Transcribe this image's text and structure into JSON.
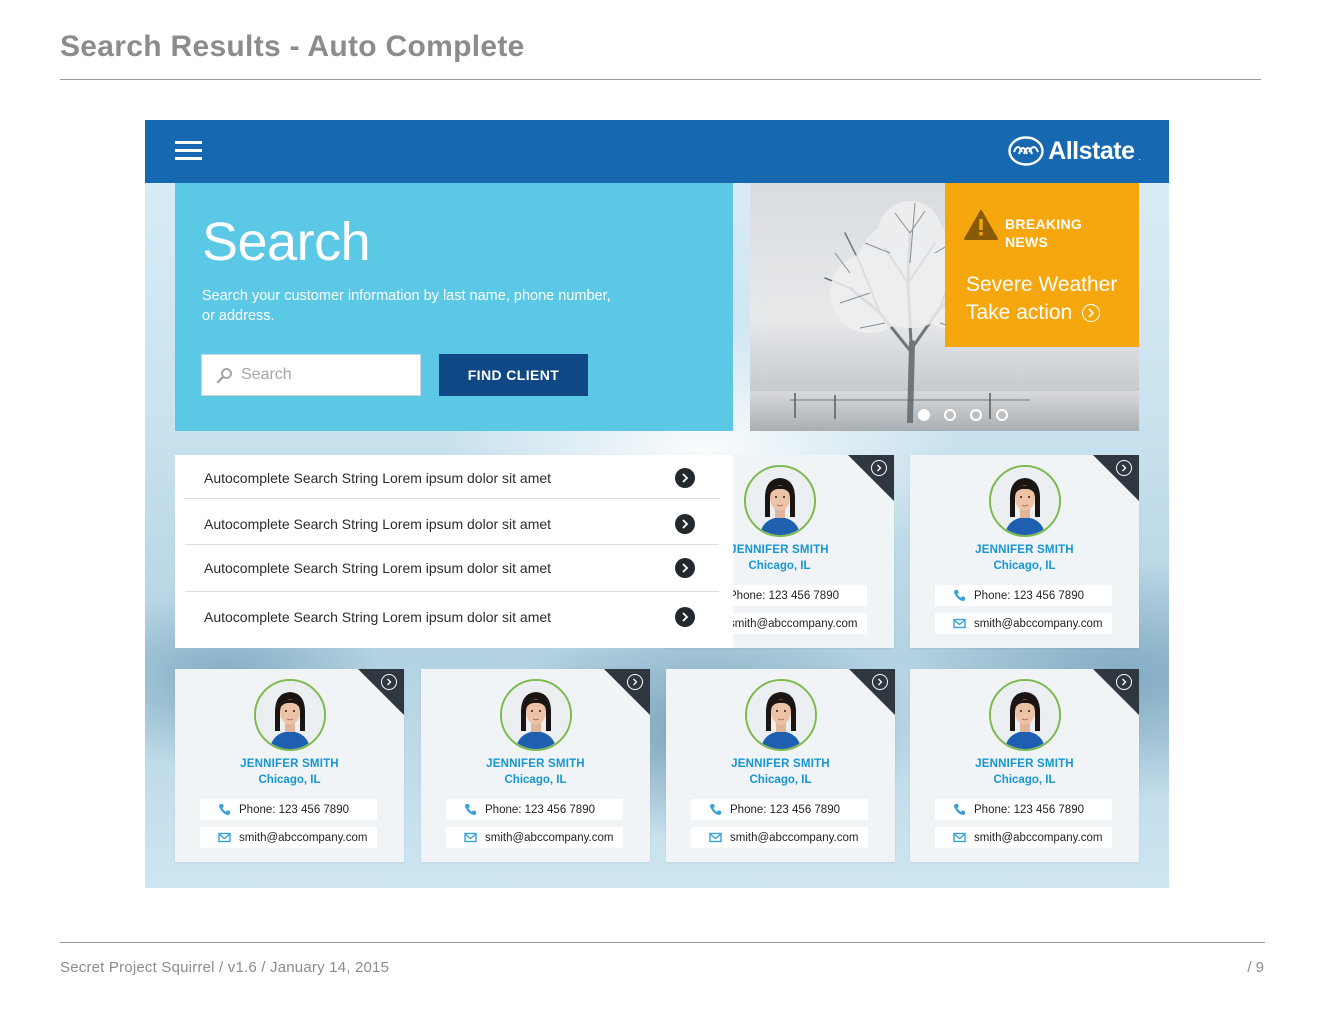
{
  "doc": {
    "title": "Search Results - Auto Complete",
    "footer": "Secret Project Squirrel  /  v1.6  / January 14, 2015",
    "page": "/  9"
  },
  "topbar": {
    "logo_text": "Allstate",
    "logo_tm": "."
  },
  "search": {
    "title": "Search",
    "description": "Search your customer information by last name, phone number, or address.",
    "placeholder": "Search",
    "button_label": "FIND CLIENT"
  },
  "hero": {
    "carousel_dots": 4,
    "active_dot": 1
  },
  "news": {
    "label": "BREAKING NEWS",
    "headline": "Severe Weather",
    "action": "Take action"
  },
  "autocomplete": {
    "items": [
      "Autocomplete Search String Lorem ipsum dolor sit amet",
      "Autocomplete Search String Lorem ipsum dolor sit amet",
      "Autocomplete Search String Lorem ipsum dolor sit amet",
      "Autocomplete Search String Lorem ipsum dolor sit amet"
    ]
  },
  "cards": [
    {
      "name": "JENNIFER SMITH",
      "city": "Chicago, IL",
      "phone": "Phone: 123 456 7890",
      "email": "smith@abccompany.com"
    },
    {
      "name": "JENNIFER SMITH",
      "city": "Chicago, IL",
      "phone": "Phone: 123 456 7890",
      "email": "smith@abccompany.com"
    },
    {
      "name": "JENNIFER SMITH",
      "city": "Chicago, IL",
      "phone": "Phone: 123 456 7890",
      "email": "smith@abccompany.com"
    },
    {
      "name": "JENNIFER SMITH",
      "city": "Chicago, IL",
      "phone": "Phone: 123 456 7890",
      "email": "smith@abccompany.com"
    },
    {
      "name": "JENNIFER SMITH",
      "city": "Chicago, IL",
      "phone": "Phone: 123 456 7890",
      "email": "smith@abccompany.com"
    },
    {
      "name": "JENNIFER SMITH",
      "city": "Chicago, IL",
      "phone": "Phone: 123 456 7890",
      "email": "smith@abccompany.com"
    }
  ],
  "colors": {
    "topbar": "#1669b1",
    "search_panel": "#5bc8e6",
    "find_button": "#0f4884",
    "news": "#f5a70d",
    "card_name": "#1796d2",
    "avatar_ring": "#7dba4d"
  },
  "icons": [
    "hamburger-icon",
    "allstate-hands-icon",
    "search-icon",
    "warning-icon",
    "chevron-right-icon",
    "phone-icon",
    "mail-icon"
  ]
}
